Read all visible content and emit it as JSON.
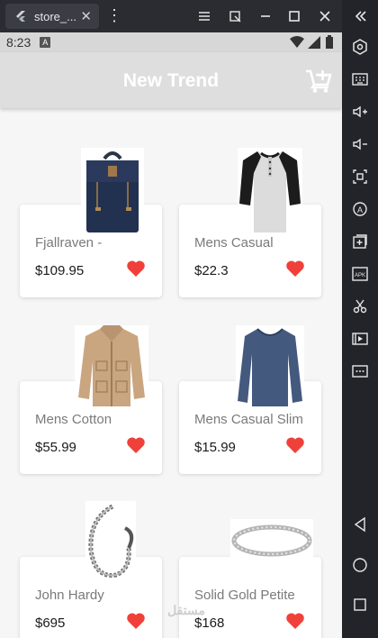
{
  "window": {
    "tab_title": "store_...",
    "tab_close": "✕"
  },
  "status_bar": {
    "time": "8:23",
    "badge": "A"
  },
  "app_bar": {
    "title": "New Trend"
  },
  "products": [
    {
      "name": "Fjallraven -",
      "price": "$109.95",
      "image": "backpack"
    },
    {
      "name": "Mens Casual",
      "price": "$22.3",
      "image": "raglan-shirt"
    },
    {
      "name": "Mens Cotton",
      "price": "$55.99",
      "image": "jacket"
    },
    {
      "name": "Mens Casual Slim",
      "price": "$15.99",
      "image": "long-sleeve-shirt"
    },
    {
      "name": "John Hardy",
      "price": "$695",
      "image": "bracelet"
    },
    {
      "name": "Solid Gold Petite",
      "price": "$168",
      "image": "ring"
    }
  ],
  "colors": {
    "heart": "#f0403a",
    "app_bar": "#dedede"
  },
  "watermark": "مستقل"
}
